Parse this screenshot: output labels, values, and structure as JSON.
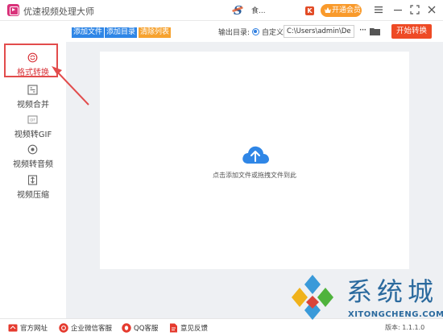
{
  "app": {
    "title": "优速视频处理大师"
  },
  "user": {
    "name": "食...",
    "badge": "K"
  },
  "header": {
    "vip_label": "开通会员",
    "menu_icon": "menu-icon",
    "minimize_icon": "minimize-icon",
    "maximize_icon": "maximize-icon",
    "close_icon": "close-icon"
  },
  "toolbar": {
    "add_file": "添加文件",
    "add_folder": "添加目录",
    "clear_list": "清除列表",
    "output_label": "输出目录:",
    "radio_custom": "自定义",
    "output_path": "C:\\Users\\admin\\Deskto",
    "more": "···",
    "start_label": "开始转换"
  },
  "sidebar": {
    "items": [
      {
        "label": "格式转换",
        "icon": "format-convert-icon",
        "active": true
      },
      {
        "label": "视频合并",
        "icon": "video-merge-icon"
      },
      {
        "label": "视频转GIF",
        "icon": "gif-icon"
      },
      {
        "label": "视频转音频",
        "icon": "audio-icon"
      },
      {
        "label": "视频压缩",
        "icon": "compress-icon"
      }
    ]
  },
  "dropzone": {
    "text": "点击添加文件或拖拽文件到此"
  },
  "footer": {
    "items": [
      {
        "label": "官方网址",
        "icon": "home-icon"
      },
      {
        "label": "企业微信客服",
        "icon": "wechat-icon"
      },
      {
        "label": "QQ客服",
        "icon": "qq-icon"
      },
      {
        "label": "意见反馈",
        "icon": "feedback-icon"
      }
    ],
    "version": "版本: 1.1.1.0"
  },
  "watermark": {
    "title": "系统城",
    "subtitle": "XITONGCHENG.COM"
  },
  "colors": {
    "accent": "#ee4a25",
    "blue": "#2f7fe0",
    "orange": "#f99a2b",
    "highlight": "#e24c4c"
  }
}
